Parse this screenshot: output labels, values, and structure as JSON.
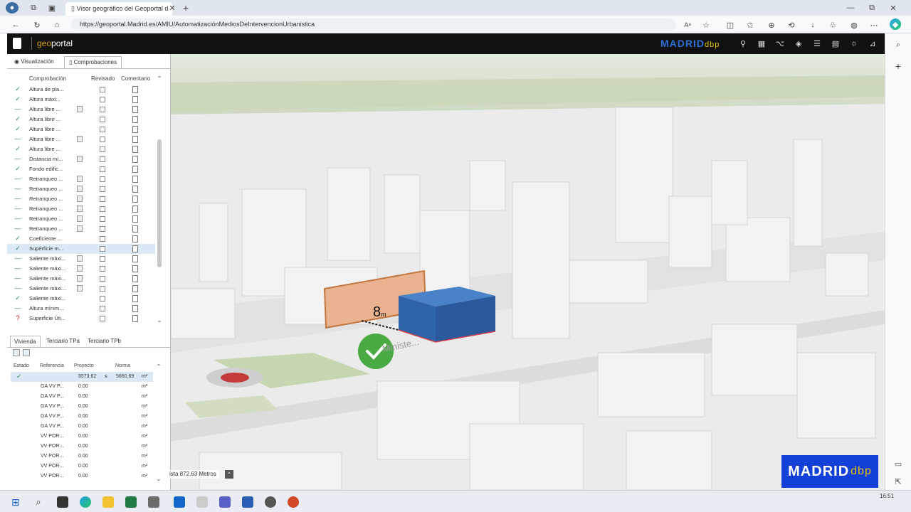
{
  "browser": {
    "tab_title": "Visor geográfico del Geoportal d",
    "url": "https://geoportal.Madrid.es/AMIU/AutomatizaciónMediosDeIntervencionUrbanistica",
    "clock": "16:51"
  },
  "geoportal": {
    "brand_geo": "geo",
    "brand_portal": "portal",
    "madrid_logo_main": "MADRID",
    "madrid_logo_sub": "dbp"
  },
  "left_panel": {
    "tabs": [
      "Visualización",
      "Comprobaciones"
    ],
    "columns": [
      "Comprobación",
      "Revisado",
      "Comentario"
    ],
    "rows": [
      {
        "status": "check",
        "name": "Altura de pla...",
        "doc": false
      },
      {
        "status": "check",
        "name": "Altura máxi...",
        "doc": false
      },
      {
        "status": "dash",
        "name": "Altura libre ...",
        "doc": true
      },
      {
        "status": "check",
        "name": "Altura libre ...",
        "doc": false
      },
      {
        "status": "check",
        "name": "Altura libre ...",
        "doc": false
      },
      {
        "status": "dash",
        "name": "Altura libre ...",
        "doc": true
      },
      {
        "status": "check",
        "name": "Altura libre ...",
        "doc": false
      },
      {
        "status": "dash",
        "name": "Distancia mí...",
        "doc": true
      },
      {
        "status": "check",
        "name": "Fondo edific...",
        "doc": false
      },
      {
        "status": "dash",
        "name": "Retranqueo ...",
        "doc": true
      },
      {
        "status": "dash",
        "name": "Retranqueo ...",
        "doc": true
      },
      {
        "status": "dash",
        "name": "Retranqueo ...",
        "doc": true
      },
      {
        "status": "dash",
        "name": "Retranqueo ...",
        "doc": true
      },
      {
        "status": "dash",
        "name": "Retranqueo ...",
        "doc": true
      },
      {
        "status": "dash",
        "name": "Retranqueo ...",
        "doc": true
      },
      {
        "status": "check",
        "name": "Coeficiente ...",
        "doc": false
      },
      {
        "status": "check",
        "name": "Superficie m...",
        "doc": false,
        "selected": true
      },
      {
        "status": "dash",
        "name": "Saliente máxi...",
        "doc": true
      },
      {
        "status": "dash",
        "name": "Saliente máxi...",
        "doc": true
      },
      {
        "status": "dash",
        "name": "Saliente máxi...",
        "doc": true
      },
      {
        "status": "dash",
        "name": "Saliente máxi...",
        "doc": true
      },
      {
        "status": "check",
        "name": "Saliente máxi...",
        "doc": false
      },
      {
        "status": "dash",
        "name": "Altura mínim...",
        "doc": false
      },
      {
        "status": "question",
        "name": "Superficie Úti...",
        "doc": false
      }
    ],
    "bottom_tabs": [
      "Vivienda",
      "Terciario TPa",
      "Terciario TPb"
    ],
    "bottom_columns": [
      "Estado",
      "Referencia",
      "Proyecto",
      "Norma"
    ],
    "bottom_rows": [
      {
        "estado": "✓",
        "ref": "",
        "proyecto": "5573.62",
        "op": "≤",
        "norma": "5660.69",
        "unit": "m²"
      },
      {
        "estado": "",
        "ref": "GA VV P...",
        "proyecto": "0.00",
        "op": "",
        "norma": "",
        "unit": "m²"
      },
      {
        "estado": "",
        "ref": "GA VV P...",
        "proyecto": "0.00",
        "op": "",
        "norma": "",
        "unit": "m²"
      },
      {
        "estado": "",
        "ref": "GA VV P...",
        "proyecto": "0.00",
        "op": "",
        "norma": "",
        "unit": "m²"
      },
      {
        "estado": "",
        "ref": "GA VV P...",
        "proyecto": "0.00",
        "op": "",
        "norma": "",
        "unit": "m²"
      },
      {
        "estado": "",
        "ref": "GA VV P...",
        "proyecto": "0.00",
        "op": "",
        "norma": "",
        "unit": "m²"
      },
      {
        "estado": "",
        "ref": "VV POR...",
        "proyecto": "0.00",
        "op": "",
        "norma": "",
        "unit": "m²"
      },
      {
        "estado": "",
        "ref": "VV POR...",
        "proyecto": "0.00",
        "op": "",
        "norma": "",
        "unit": "m²"
      },
      {
        "estado": "",
        "ref": "VV POR...",
        "proyecto": "0.00",
        "op": "",
        "norma": "",
        "unit": "m²"
      },
      {
        "estado": "",
        "ref": "VV POR...",
        "proyecto": "0.00",
        "op": "",
        "norma": "",
        "unit": "m²"
      },
      {
        "estado": "",
        "ref": "VV POR...",
        "proyecto": "0.00",
        "op": "",
        "norma": "",
        "unit": "m²"
      }
    ]
  },
  "map": {
    "distance_label": "8",
    "distance_unit": "m",
    "street_label": "Ministe...",
    "scale_text": "ista 872,63 Metros"
  }
}
